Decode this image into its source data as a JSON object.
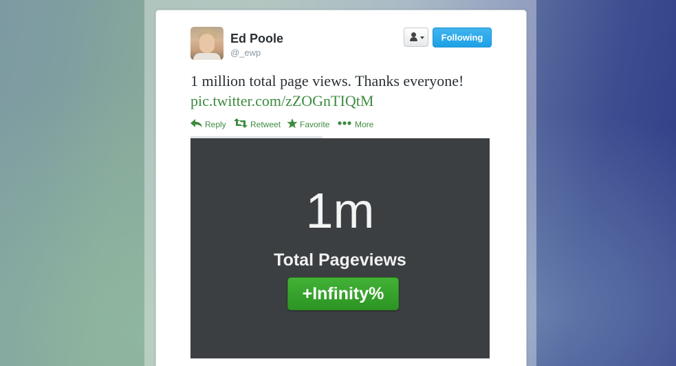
{
  "tweet": {
    "author_name": "Ed Poole",
    "author_handle": "@_ewp",
    "follow_button_label": "Following",
    "text": "1 million total page views. Thanks everyone!",
    "link": "pic.twitter.com/zZOGnTIQtM"
  },
  "actions": {
    "reply": "Reply",
    "retweet": "Retweet",
    "favorite": "Favorite",
    "more": "More"
  },
  "media": {
    "big_number": "1m",
    "subtitle": "Total Pageviews",
    "badge": "+Infinity%"
  },
  "icons": [
    "user-icon",
    "reply-icon",
    "retweet-icon",
    "star-icon",
    "more-icon"
  ],
  "colors": {
    "link": "#3d8b3f",
    "follow_button": "#2aa6e8",
    "media_background": "#3b3f42",
    "badge_green": "#37a22d"
  }
}
